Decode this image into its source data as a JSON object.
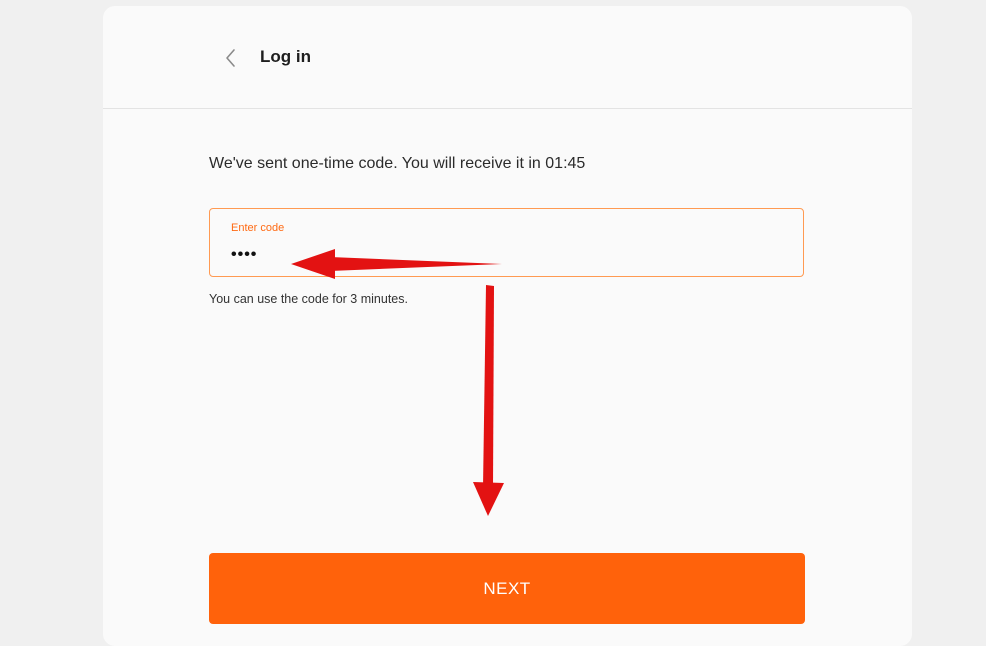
{
  "header": {
    "back_icon": "chevron-left-icon",
    "title": "Log in"
  },
  "otp": {
    "message": "We've sent one-time code. You will receive it in 01:45",
    "field_label": "Enter code",
    "field_value": "••••",
    "helper": "You can use the code for 3 minutes."
  },
  "actions": {
    "next_label": "NEXT"
  },
  "colors": {
    "accent": "#ff620b",
    "annotation_arrow": "#e31212"
  }
}
